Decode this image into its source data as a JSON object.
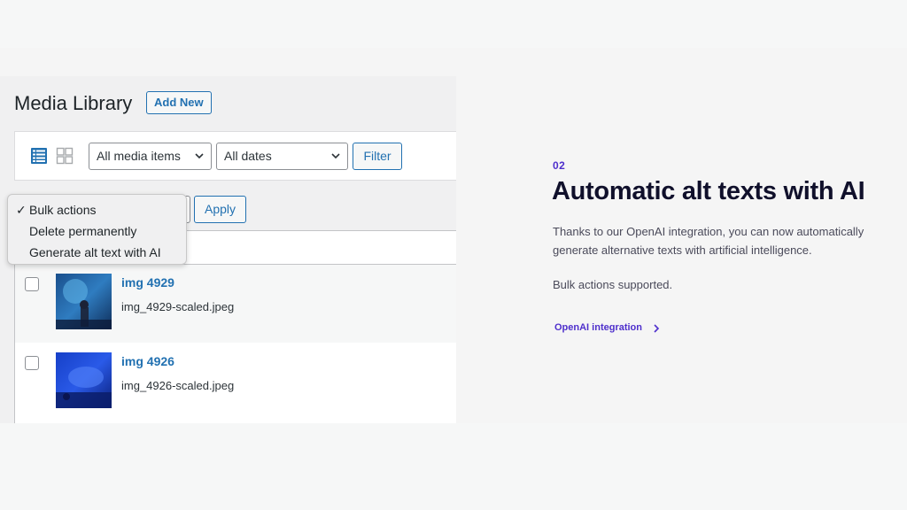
{
  "wp": {
    "page_title": "Media Library",
    "add_new_label": "Add New",
    "filters": {
      "media_select": "All media items",
      "dates_select": "All dates",
      "filter_label": "Filter"
    },
    "bulk": {
      "apply_label": "Apply",
      "dropdown_options": [
        "Bulk actions",
        "Delete permanently",
        "Generate alt text with AI"
      ],
      "selected_index": 0
    },
    "media_items": [
      {
        "title": "img 4929",
        "filename": "img_4929-scaled.jpeg"
      },
      {
        "title": "img 4926",
        "filename": "img_4926-scaled.jpeg"
      }
    ],
    "icons": {
      "list_view": "list-view-icon",
      "grid_view": "grid-view-icon",
      "chevron": "chevron-down-icon"
    }
  },
  "feature": {
    "number": "02",
    "headline": "Automatic alt texts with AI",
    "description": "Thanks to our OpenAI integration, you can now automatically generate alternative texts with artificial intelligence.",
    "bulk_note": "Bulk actions supported.",
    "link_label": "OpenAI integration"
  },
  "colors": {
    "wp_blue": "#2271b1",
    "accent_purple": "#4e2fcc",
    "headline": "#10102b"
  }
}
